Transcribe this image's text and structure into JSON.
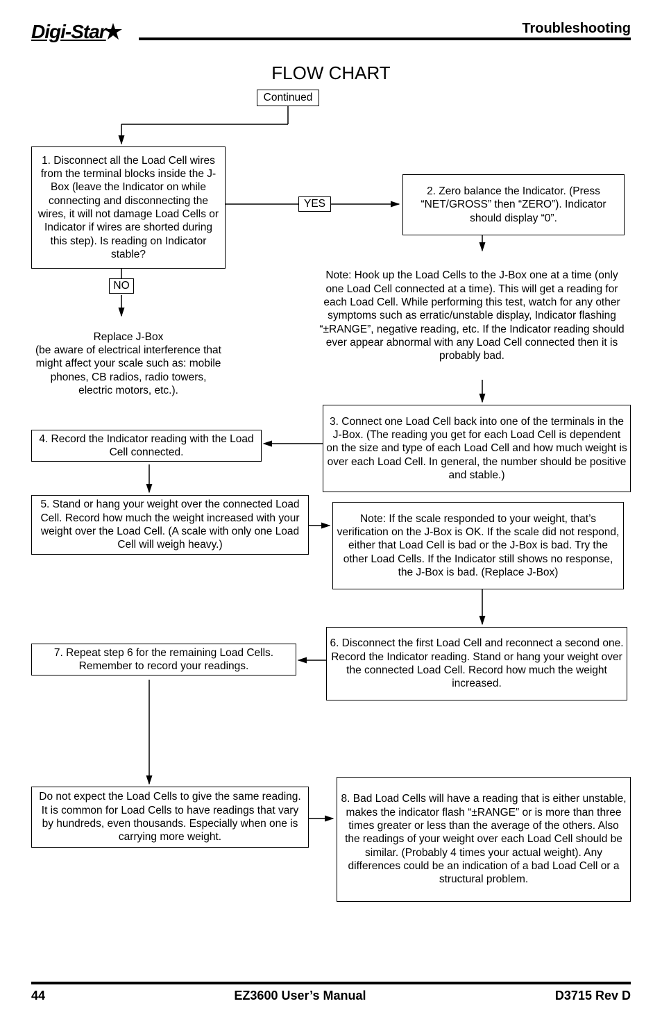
{
  "header": {
    "logo": "Digi-Star",
    "section": "Troubleshooting"
  },
  "title": "FLOW CHART",
  "continued": "Continued",
  "yes": "YES",
  "no": "NO",
  "boxes": {
    "b1": "1. Disconnect all the Load Cell wires from the terminal blocks inside the J-Box (leave the Indicator on while connecting and disconnecting the wires, it will not damage Load Cells or Indicator if wires are shorted during this step). Is reading on Indicator stable?",
    "b2": "2. Zero balance the Indicator. (Press “NET/GROSS” then “ZERO”). Indicator should display “0”.",
    "note1": "Note: Hook up the Load Cells to the J-Box one at a time (only one Load Cell connected at a time). This will get a reading for each Load Cell. While performing this test, watch for any other symptoms such as erratic/unstable display, Indicator flashing “±RANGE”, negative reading, etc. If the Indicator reading should ever appear abnormal with any Load Cell connected then it is probably bad.",
    "replace": "Replace J-Box\n(be aware of electrical interference that might affect your scale such as: mobile phones, CB radios, radio towers, electric motors, etc.).",
    "b3": "3. Connect one Load Cell back into one of the terminals in the J-Box. (The reading you get for each Load Cell is dependent on the size and type of each Load Cell and how much weight is over each Load Cell. In general, the number should be positive and stable.)",
    "b4": "4. Record the Indicator reading with the Load Cell connected.",
    "b5": "5. Stand or hang your weight over the connected Load Cell. Record how much the weight increased with your weight over the Load Cell. (A scale with only one Load Cell will weigh heavy.)",
    "note2": "Note: If the scale responded to your weight, that’s verification on the J-Box is OK. If the scale did not respond, either that Load Cell is bad or the J-Box is bad. Try the other Load Cells. If the Indicator still shows no response, the J-Box is bad. (Replace J-Box)",
    "b6": "6. Disconnect the first Load Cell and reconnect a second one. Record the Indicator reading. Stand or hang your weight over the connected Load Cell. Record how much the weight increased.",
    "b7": "7. Repeat step 6 for the remaining Load Cells. Remember to record your readings.",
    "expect": "Do not expect the Load Cells to give the same reading. It is common for Load Cells to have readings that vary by hundreds, even thousands. Especially when one is carrying more weight.",
    "b8": "8. Bad Load Cells will have a reading that is either unstable, makes the indicator flash “±RANGE” or is more than three times greater or less than the average of the others. Also the readings of your weight over each Load Cell should be similar. (Probably 4 times your actual weight). Any differences could be an indication of a bad Load Cell or a structural problem."
  },
  "footer": {
    "page": "44",
    "center": "EZ3600 User’s Manual",
    "right": "D3715 Rev D"
  },
  "chart_data": {
    "type": "flowchart",
    "nodes": [
      {
        "id": "continued",
        "label": "Continued"
      },
      {
        "id": "1",
        "label": "Disconnect Load Cell wires... Is reading on Indicator stable?"
      },
      {
        "id": "yes",
        "label": "YES"
      },
      {
        "id": "no",
        "label": "NO"
      },
      {
        "id": "2",
        "label": "Zero balance the Indicator (display 0)"
      },
      {
        "id": "replace",
        "label": "Replace J-Box (electrical interference warning)"
      },
      {
        "id": "note1",
        "label": "Hook up Load Cells one at a time; watch for abnormal readings"
      },
      {
        "id": "3",
        "label": "Connect one Load Cell; number should be positive and stable"
      },
      {
        "id": "4",
        "label": "Record Indicator reading with Load Cell connected"
      },
      {
        "id": "5",
        "label": "Stand/hang weight over connected Load Cell; record increase"
      },
      {
        "id": "note2",
        "label": "If scale responded J-Box OK; else Load Cell or J-Box bad"
      },
      {
        "id": "6",
        "label": "Disconnect first, reconnect second; record reading and weight increase"
      },
      {
        "id": "7",
        "label": "Repeat step 6 for remaining Load Cells; record readings"
      },
      {
        "id": "expect",
        "label": "Load Cell readings may vary by hundreds/thousands"
      },
      {
        "id": "8",
        "label": "Bad Load Cells: unstable, ±RANGE, >3x or <1/3x average; weight readings ~4x actual"
      }
    ],
    "edges": [
      {
        "from": "continued",
        "to": "1"
      },
      {
        "from": "1",
        "to": "yes",
        "label": "YES"
      },
      {
        "from": "yes",
        "to": "2"
      },
      {
        "from": "1",
        "to": "no",
        "label": "NO"
      },
      {
        "from": "no",
        "to": "replace"
      },
      {
        "from": "2",
        "to": "note1"
      },
      {
        "from": "note1",
        "to": "3"
      },
      {
        "from": "3",
        "to": "4"
      },
      {
        "from": "4",
        "to": "5"
      },
      {
        "from": "5",
        "to": "note2"
      },
      {
        "from": "note2",
        "to": "6"
      },
      {
        "from": "6",
        "to": "7"
      },
      {
        "from": "7",
        "to": "expect"
      },
      {
        "from": "expect",
        "to": "8"
      }
    ]
  }
}
